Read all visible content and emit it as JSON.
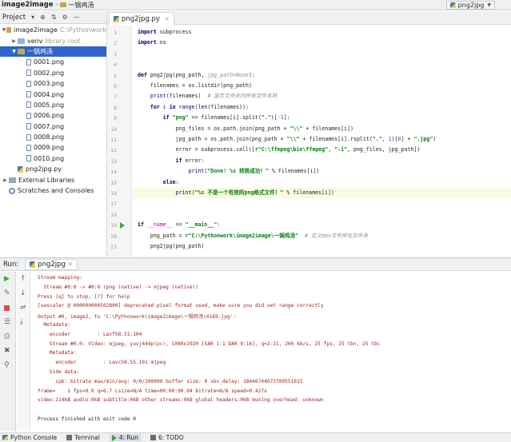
{
  "nav": {
    "project": "image2image",
    "folder": "一锅鸡汤",
    "run_config": "png2jpg"
  },
  "project_panel": {
    "title": "Project",
    "tree": [
      {
        "label": "image2image",
        "sub": "C:\\Pythonwork",
        "kind": "folder",
        "level": 0,
        "arrow": "▼"
      },
      {
        "label": "venv",
        "sub": "library root",
        "kind": "folder-blue",
        "level": 1,
        "arrow": "▶"
      },
      {
        "label": "一锅鸡汤",
        "sub": "",
        "kind": "folder",
        "level": 1,
        "arrow": "▼",
        "selected": true
      },
      {
        "label": "0001.png",
        "sub": "",
        "kind": "file",
        "level": 2
      },
      {
        "label": "0002.png",
        "sub": "",
        "kind": "file",
        "level": 2
      },
      {
        "label": "0003.png",
        "sub": "",
        "kind": "file",
        "level": 2
      },
      {
        "label": "0004.png",
        "sub": "",
        "kind": "file",
        "level": 2
      },
      {
        "label": "0005.png",
        "sub": "",
        "kind": "file",
        "level": 2
      },
      {
        "label": "0006.png",
        "sub": "",
        "kind": "file",
        "level": 2
      },
      {
        "label": "0007.png",
        "sub": "",
        "kind": "file",
        "level": 2
      },
      {
        "label": "0008.png",
        "sub": "",
        "kind": "file",
        "level": 2
      },
      {
        "label": "0009.png",
        "sub": "",
        "kind": "file",
        "level": 2
      },
      {
        "label": "0010.png",
        "sub": "",
        "kind": "file",
        "level": 2
      },
      {
        "label": "png2jpg.py",
        "sub": "",
        "kind": "py",
        "level": 1
      },
      {
        "label": "External Libraries",
        "sub": "",
        "kind": "lib",
        "level": 0,
        "arrow": "▶"
      },
      {
        "label": "Scratches and Consoles",
        "sub": "",
        "kind": "scratch",
        "level": 0,
        "arrow": ""
      }
    ]
  },
  "editor": {
    "tab_label": "png2jpg.py",
    "line_numbers": [
      "1",
      "2",
      "3",
      "4",
      "5",
      "6",
      "7",
      "8",
      "9",
      "10",
      "11",
      "12",
      "13",
      "14",
      "15",
      "16",
      "17",
      "18",
      "19",
      "20",
      "21"
    ],
    "code": [
      "<span class=\"kw\">import</span> subprocess",
      "<span class=\"kw\">import</span> os",
      "",
      "",
      "<span class=\"kw\">def</span> png2jpg(png_path, <span class=\"cm\">jpg_path=None</span>):",
      "    filenames = os.listdir(png_path)",
      "    <span class=\"bi\">print</span>(filenames)  <span class=\"cm\"># 显示文件夹内所有文件名称</span>",
      "    <span class=\"kw\">for</span> i <span class=\"kw\">in</span> <span class=\"bi\">range</span>(<span class=\"bi\">len</span>(filenames)):",
      "        <span class=\"kw\">if</span> <span class=\"str\">\"png\"</span> == filenames[i].split(<span class=\"str\">\".\"</span>)[<span class=\"num\">-1</span>]:",
      "            png_files = os.path.join(png_path + <span class=\"str\">\"\\\\\"</span> + filenames[i])",
      "            jpg_path = os.path.join(png_path + <span class=\"str\">\"\\\\\"</span> + filenames[i].rsplit(<span class=\"str\">\".\"</span>, <span class=\"num\">1</span>)[<span class=\"num\">0</span>] + <span class=\"str\">\".jpg\"</span>)",
      "            error = subprocess.call([<span class=\"str\">r\"C:\\ffmpeg\\bin\\ffmpeg\"</span>, <span class=\"str\">\"-i\"</span>, png_files, jpg_path])",
      "            <span class=\"kw\">if</span> error:",
      "                <span class=\"bi\">print</span>(<span class=\"str\">\"Done! %s 转换成功！\"</span> % filenames[i])",
      "        <span class=\"kw\">else</span>:",
      "            <span class=\"bi\">print</span>(<span class=\"str\">\"%s 不是一个有效的png格式文件！\"</span> % filenames[i])",
      "",
      "",
      "<span class=\"kw\">if</span> <span class=\"dunder\">__name__</span> == <span class=\"str\">\"__main__\"</span>:",
      "    png_path = <span class=\"str\">r\"C:\\Pythonwork\\image2image\\一锅鸡汤\"</span>  <span class=\"cm\"># 定义mov文件所在文件夹</span>",
      "    png2jpg(png_path)"
    ],
    "current_line": 16,
    "run_marker_line": 19
  },
  "run_panel": {
    "label": "Run:",
    "tab_label": "png2jpg",
    "tools": [
      "▶",
      "↑",
      "↓",
      "⇌",
      "🖶",
      "🗑",
      "📌"
    ],
    "output": [
      {
        "text": "Stream mapping:",
        "ok": false
      },
      {
        "text": "  Stream #0:0 -> #0:0 (png (native) -> mjpeg (native))",
        "ok": false
      },
      {
        "text": "Press [q] to stop, [?] for help",
        "ok": false
      },
      {
        "text": "[swscaler @ 000000000502800] deprecated pixel format used, make sure you did set range correctly",
        "ok": false
      },
      {
        "text": "Output #0, image2, to 'C:\\Pythonwork\\image2image\\一锅鸡汤\\0169.jpg':",
        "ok": false
      },
      {
        "text": "  Metadata:",
        "ok": false
      },
      {
        "text": "    encoder         : Lavf58.31.104",
        "ok": false
      },
      {
        "text": "    Stream #0:0: Video: mjpeg, yuvj444p(pc), 1080x1920 [SAR 1:1 DAR 9:16], q=2-31, 200 kb/s, 25 fps, 25 tbn, 25 tbc",
        "ok": false
      },
      {
        "text": "    Metadata:",
        "ok": false
      },
      {
        "text": "      encoder         : Lavc58.55.101 mjpeg",
        "ok": false
      },
      {
        "text": "    Side data:",
        "ok": false
      },
      {
        "text": "      cpb: bitrate max/min/avg: 0/0/200000 buffer size: 0 vbv_delay: 18446744073709551615",
        "ok": false
      },
      {
        "text": "frame=    1 fps=0.0 q=6.7 Lsize=N/A time=00:00:00.04 bitrate=N/A speed=0.427x",
        "ok": false
      },
      {
        "text": "video:114kB audio:0kB subtitle:0kB other streams:0kB global headers:0kB muxing overhead: unknown",
        "ok": false
      },
      {
        "text": "",
        "ok": true
      },
      {
        "text": "Process finished with exit code 0",
        "ok": true
      }
    ]
  },
  "status_bar": {
    "items": [
      {
        "label": "Python Console",
        "icon": "py",
        "active": false
      },
      {
        "label": "Terminal",
        "icon": "term",
        "active": false
      },
      {
        "label": "4: Run",
        "icon": "run",
        "active": true
      },
      {
        "label": "6: TODO",
        "icon": "todo",
        "active": false
      }
    ]
  }
}
